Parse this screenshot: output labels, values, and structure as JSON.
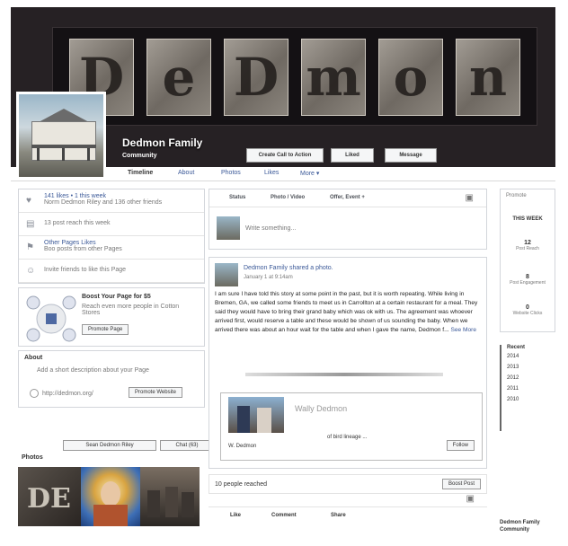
{
  "cover": {
    "letters": [
      "D",
      "e",
      "D",
      "m",
      "o",
      "n"
    ],
    "page_name": "Dedmon Family",
    "page_category": "Community",
    "buttons": {
      "create_call_to_action": "Create Call to Action",
      "liked": "Liked",
      "message": "Message"
    }
  },
  "nav": {
    "items": [
      "Timeline",
      "About",
      "Photos",
      "Likes",
      "More ▾"
    ]
  },
  "left": {
    "likes_line": "141 likes • 1 this week",
    "likes_sub": "Norm Dedmon Riley and 136 other friends",
    "post_reach": "13 post reach this week",
    "other_pages_title": "Other Pages Likes",
    "other_pages_sub": "Boo posts from other Pages",
    "invite": "Invite friends to like this Page",
    "promo_title": "Boost Your Page for $5",
    "promo_sub": "Reach even more people in Cotton Stores",
    "promo_button": "Promote Page",
    "about_title": "About",
    "about_prompt": "Add a short description about your Page",
    "website_label": "http://dedmon.org/",
    "promote_website_button": "Promote Website",
    "photos_title": "Photos"
  },
  "bottom_tags": {
    "tag_one": "Sean Dedmon Riley",
    "tag_two": "Chat (63)"
  },
  "center": {
    "composer_tabs": [
      "Status",
      "Photo / Video",
      "Offer, Event +"
    ],
    "composer_placeholder": "Write something...",
    "post_author": "Dedmon Family shared a photo.",
    "post_time": "January 1 at 9:14am",
    "post_body": "I am sure I have told this story at some point in the past, but it is worth repeating. While living in Bremen, GA, we called some friends to meet us in Carrollton at a certain restaurant for a meal. They said they would have to bring their grand baby which was ok with us. The agreement was whoever arrived first, would reserve a table and these would be shown of us sounding the baby. When we arrived there was about an hour wait for the table and when I gave the name, Dedmon f...",
    "see_more": "See More",
    "shared_name": "Wally Dedmon",
    "shared_sub": "of bird lineage ...",
    "shared_link": "W. Dedmon",
    "follow_label": "Follow",
    "reached": "10 people reached",
    "boost_post": "Boost Post",
    "actions": [
      "Like",
      "Comment",
      "Share"
    ]
  },
  "right": {
    "header": "Promote",
    "this_week": "THIS WEEK",
    "stats": [
      {
        "value": "12",
        "label": "Post Reach"
      },
      {
        "value": "8",
        "label": "Post Engagement"
      },
      {
        "value": "0",
        "label": "Website Clicks"
      }
    ],
    "recent_label": "Recent",
    "years": [
      "2014",
      "2013",
      "2012",
      "2011",
      "2010"
    ],
    "footer": "Dedmon Family Community"
  }
}
